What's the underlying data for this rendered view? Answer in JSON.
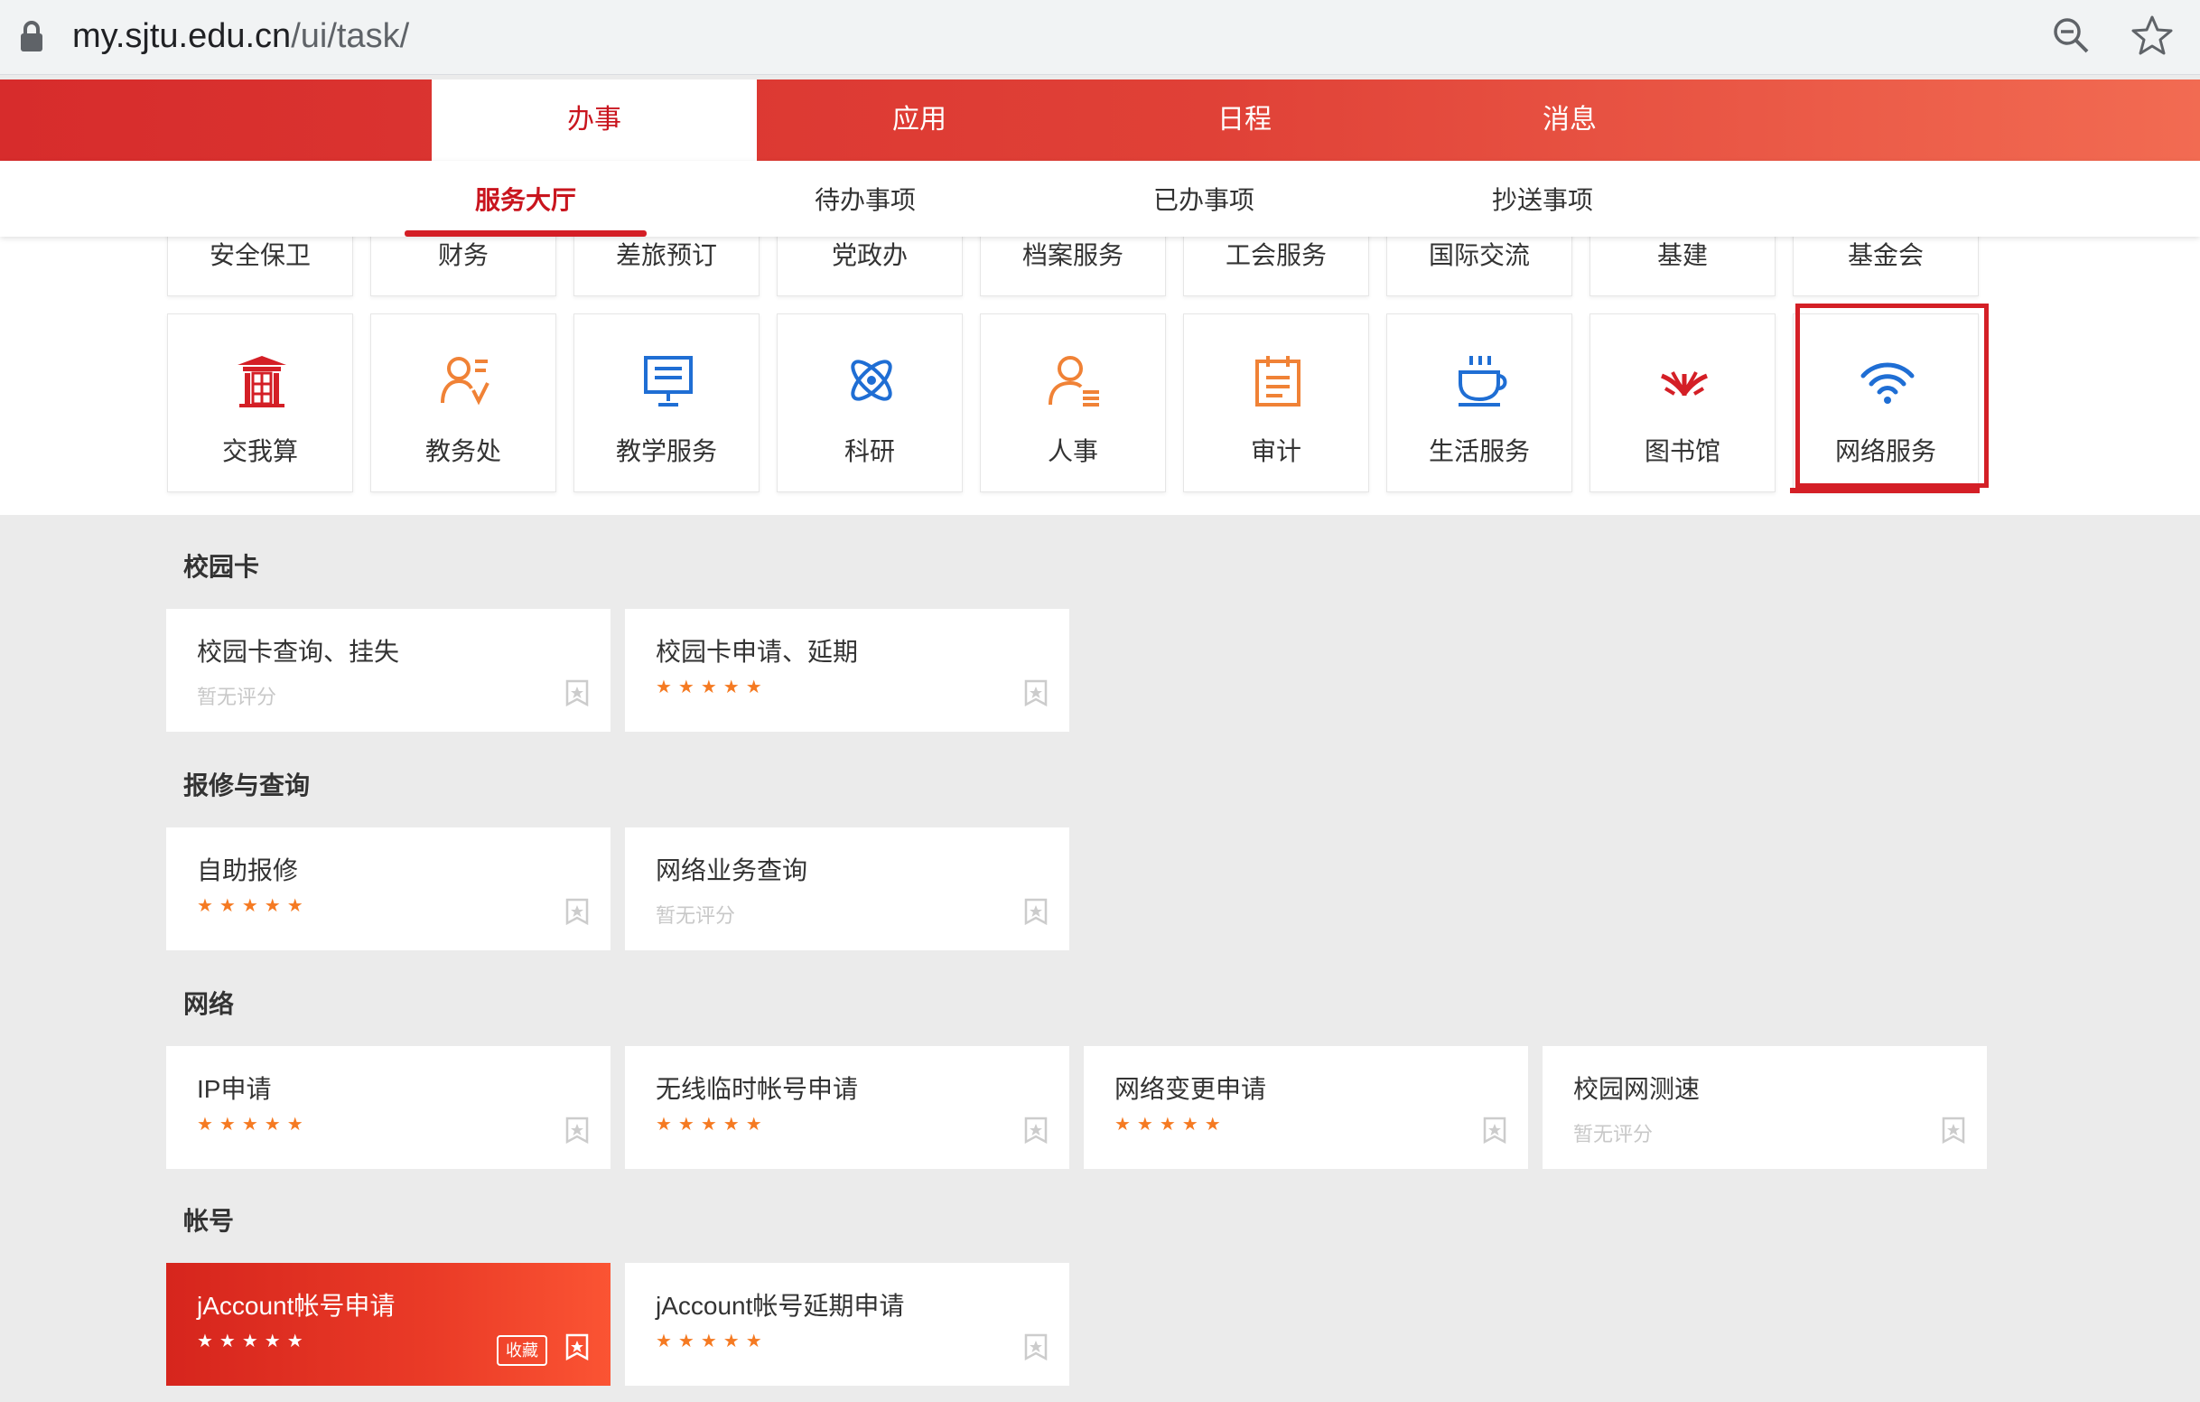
{
  "browser": {
    "url_host": "my.sjtu.edu.cn",
    "url_path": "/ui/task/"
  },
  "main_tabs": [
    {
      "label": "办事",
      "active": true
    },
    {
      "label": "应用",
      "active": false
    },
    {
      "label": "日程",
      "active": false
    },
    {
      "label": "消息",
      "active": false
    }
  ],
  "sub_tabs": [
    {
      "label": "服务大厅",
      "active": true
    },
    {
      "label": "待办事项",
      "active": false
    },
    {
      "label": "已办事项",
      "active": false
    },
    {
      "label": "抄送事项",
      "active": false
    }
  ],
  "categories_row1": [
    "安全保卫",
    "财务",
    "差旅预订",
    "党政办",
    "档案服务",
    "工会服务",
    "国际交流",
    "基建",
    "基金会"
  ],
  "categories_row2": [
    {
      "label": "交我算",
      "icon": "sjtu-gate-icon"
    },
    {
      "label": "教务处",
      "icon": "person-list-icon"
    },
    {
      "label": "教学服务",
      "icon": "presentation-board-icon"
    },
    {
      "label": "科研",
      "icon": "atom-icon"
    },
    {
      "label": "人事",
      "icon": "person-doc-icon"
    },
    {
      "label": "审计",
      "icon": "calendar-list-icon"
    },
    {
      "label": "生活服务",
      "icon": "coffee-cup-icon"
    },
    {
      "label": "图书馆",
      "icon": "library-logo-icon"
    },
    {
      "label": "网络服务",
      "icon": "wifi-icon"
    }
  ],
  "sections": [
    {
      "title": "校园卡",
      "cards": [
        {
          "title": "校园卡查询、挂失",
          "rating": null
        },
        {
          "title": "校园卡申请、延期",
          "rating": 5
        }
      ]
    },
    {
      "title": "报修与查询",
      "cards": [
        {
          "title": "自助报修",
          "rating": 5
        },
        {
          "title": "网络业务查询",
          "rating": null
        }
      ]
    },
    {
      "title": "网络",
      "cards": [
        {
          "title": "IP申请",
          "rating": 5
        },
        {
          "title": "无线临时帐号申请",
          "rating": 5
        },
        {
          "title": "网络变更申请",
          "rating": 5
        },
        {
          "title": "校园网测速",
          "rating": null
        }
      ]
    },
    {
      "title": "帐号",
      "cards": [
        {
          "title": "jAccount帐号申请",
          "rating": 5,
          "highlighted": true
        },
        {
          "title": "jAccount帐号延期申请",
          "rating": 5
        }
      ]
    }
  ],
  "no_rating_text": "暂无评分",
  "stars_text": "★★★★★",
  "collect_label": "收藏",
  "colors": {
    "brand_red": "#d41f26",
    "star_orange": "#f57a22"
  }
}
